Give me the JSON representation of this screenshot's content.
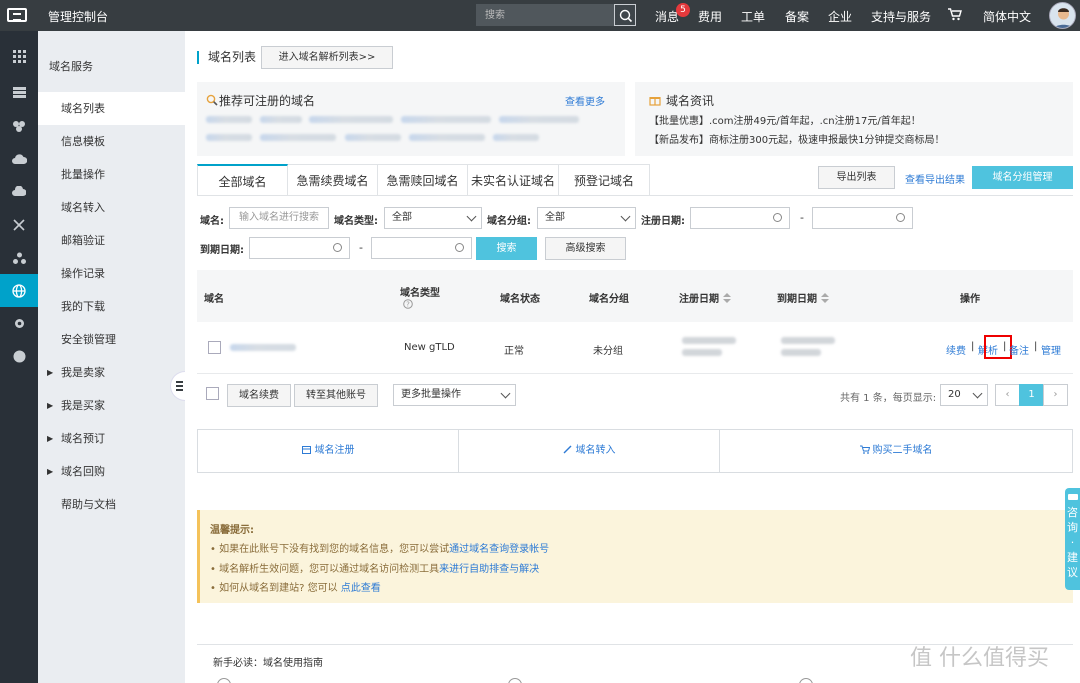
{
  "topbar": {
    "title": "管理控制台",
    "search_placeholder": "搜索",
    "nav": {
      "messages": "消息",
      "messages_badge": "5",
      "fees": "费用",
      "tickets": "工单",
      "filing": "备案",
      "enterprise": "企业",
      "support": "支持与服务",
      "language": "简体中文"
    }
  },
  "sidebar": {
    "heading": "域名服务",
    "items": [
      {
        "label": "域名列表"
      },
      {
        "label": "信息模板"
      },
      {
        "label": "批量操作"
      },
      {
        "label": "域名转入"
      },
      {
        "label": "邮箱验证"
      },
      {
        "label": "操作记录"
      },
      {
        "label": "我的下载"
      },
      {
        "label": "安全锁管理"
      },
      {
        "label": "我是卖家"
      },
      {
        "label": "我是买家"
      },
      {
        "label": "域名预订"
      },
      {
        "label": "域名回购"
      },
      {
        "label": "帮助与文档"
      }
    ]
  },
  "main": {
    "page_title": "域名列表",
    "goto_dns_label": "进入域名解析列表>>",
    "recommend_title": "推荐可注册的域名",
    "recommend_more": "查看更多",
    "news_title": "域名资讯",
    "news": [
      "【批量优惠】.com注册49元/首年起，.cn注册17元/首年起！",
      "【新品发布】商标注册300元起，极速申报最快1分钟提交商标局！"
    ],
    "tabs": [
      "全部域名",
      "急需续费域名",
      "急需赎回域名",
      "未实名认证域名",
      "预登记域名"
    ],
    "export_label": "导出列表",
    "export_result_label": "查看导出结果",
    "group_manage_label": "域名分组管理",
    "filters": {
      "domain_label": "域名:",
      "domain_placeholder": "输入域名进行搜索",
      "type_label": "域名类型:",
      "type_value": "全部",
      "group_label": "域名分组:",
      "group_value": "全部",
      "reg_date_label": "注册日期:",
      "exp_date_label": "到期日期:",
      "dash": "-",
      "search_label": "搜索",
      "advanced_label": "高级搜索"
    },
    "table": {
      "headers": {
        "domain": "域名",
        "type": "域名类型",
        "status": "域名状态",
        "group": "域名分组",
        "reg_date": "注册日期",
        "exp_date": "到期日期",
        "ops": "操作"
      },
      "row": {
        "type": "New gTLD",
        "status": "正常",
        "group": "未分组",
        "ops": {
          "renew": "续费",
          "resolve": "解析",
          "note": "备注",
          "manage": "管理",
          "sep": "|"
        }
      }
    },
    "footer": {
      "renew_label": "域名续费",
      "transfer_label": "转至其他账号",
      "more_batch_label": "更多批量操作",
      "total_text": "共有 1 条，每页显示:",
      "page_size": "20",
      "current_page": "1"
    },
    "quick": {
      "register": "域名注册",
      "transfer_in": "域名转入",
      "buy_second_hand": "购买二手域名"
    },
    "notice": {
      "title": "温馨提示:",
      "line1_text": "• 如果在此账号下没有找到您的域名信息，您可以尝试",
      "line1_link": "通过域名查询登录帐号",
      "line2_text": "• 域名解析生效问题，您可以通过域名访问检测工具",
      "line2_link": "来进行自助排查与解决",
      "line3_text": "• 如何从域名到建站? 您可以 ",
      "line3_link": "点此查看"
    },
    "guide_title": "新手必读：域名使用指南"
  },
  "float_consult": "咨询·建议",
  "watermark": "值 什么值得买",
  "colors": {
    "topbar": "#373d41",
    "rail": "#293038",
    "accent": "#00a2ca",
    "primary_button": "#4fc3de",
    "link": "#2e7bd5",
    "highlight": "#e00000"
  }
}
